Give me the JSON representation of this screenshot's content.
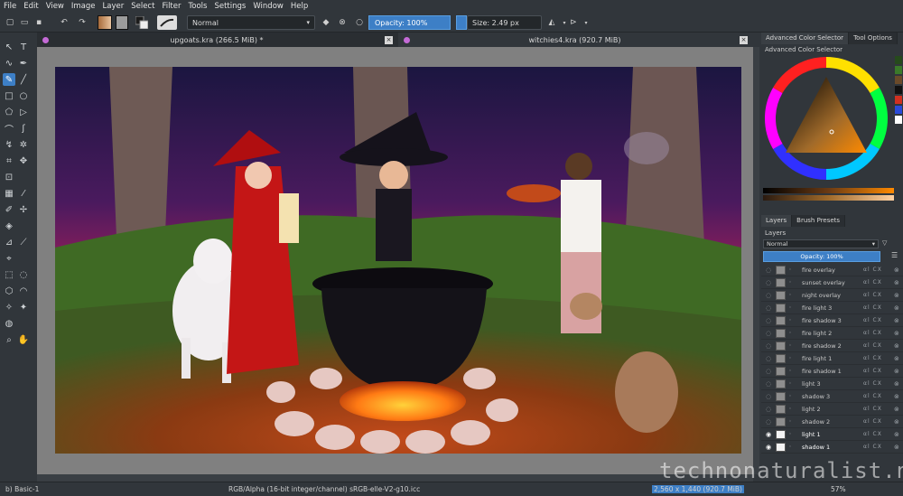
{
  "menubar": {
    "items": [
      "File",
      "Edit",
      "View",
      "Image",
      "Layer",
      "Select",
      "Filter",
      "Tools",
      "Settings",
      "Window",
      "Help"
    ]
  },
  "toolbar": {
    "blend_mode": "Normal",
    "opacity_label": "Opacity: 100%",
    "size_label": "Size: 2.49 px",
    "fg_color": "#a76b3b",
    "bg_color": "#c8c8c8"
  },
  "tabs": [
    {
      "title": "upgoats.kra (266.5 MiB) *"
    },
    {
      "title": "witchies4.kra (920.7 MiB)"
    }
  ],
  "dock": {
    "tabs": [
      "Advanced Color Selector",
      "Tool Options"
    ],
    "color_section_title": "Advanced Color Selector",
    "layer_tabs": [
      "Layers",
      "Brush Presets"
    ],
    "layers_title": "Layers",
    "layers_blend": "Normal",
    "layers_opacity": "Opacity:  100%",
    "layers": [
      {
        "name": "fire overlay",
        "visible": false
      },
      {
        "name": "sunset overlay",
        "visible": false
      },
      {
        "name": "night overlay",
        "visible": false
      },
      {
        "name": "fire light 3",
        "visible": false
      },
      {
        "name": "fire shadow 3",
        "visible": false
      },
      {
        "name": "fire light 2",
        "visible": false
      },
      {
        "name": "fire shadow 2",
        "visible": false
      },
      {
        "name": "fire light 1",
        "visible": false
      },
      {
        "name": "fire shadow 1",
        "visible": false
      },
      {
        "name": "light 3",
        "visible": false
      },
      {
        "name": "shadow 3",
        "visible": false
      },
      {
        "name": "light 2",
        "visible": false
      },
      {
        "name": "shadow 2",
        "visible": false
      },
      {
        "name": "light 1",
        "visible": true
      },
      {
        "name": "shadow 1",
        "visible": true
      }
    ],
    "layer_flags": "αl  CX"
  },
  "statusbar": {
    "brush": "b) Basic-1",
    "color_model": "RGB/Alpha (16-bit integer/channel)  sRGB-elle-V2-g10.icc",
    "image_size": "2,560 x 1,440 (920.7 MiB)",
    "zoom": "57%"
  },
  "watermark": "technonaturalist.net",
  "icons": {
    "toolbox": [
      "select-icon",
      "text-icon",
      "freehand-icon",
      "calligraphy-icon",
      "brush-icon",
      "line-icon",
      "rectangle-icon",
      "ellipse-icon",
      "polygon-icon",
      "polyline-icon",
      "bezier-icon",
      "freehand-path-icon",
      "dynamic-brush-icon",
      "multibrush-icon",
      "crop-icon",
      "move-icon",
      "transform-icon",
      "gradient-icon",
      "color-picker-icon",
      "smart-patch-icon",
      "fill-icon",
      "assistant-icon",
      "measure-icon",
      "reference-icon",
      "rect-select-icon",
      "ellipse-select-icon",
      "polygon-select-icon",
      "freehand-select-icon",
      "contiguous-select-icon",
      "similar-select-icon",
      "bezier-select-icon",
      "magnetic-select-icon",
      "zoom-icon",
      "pan-icon"
    ]
  }
}
